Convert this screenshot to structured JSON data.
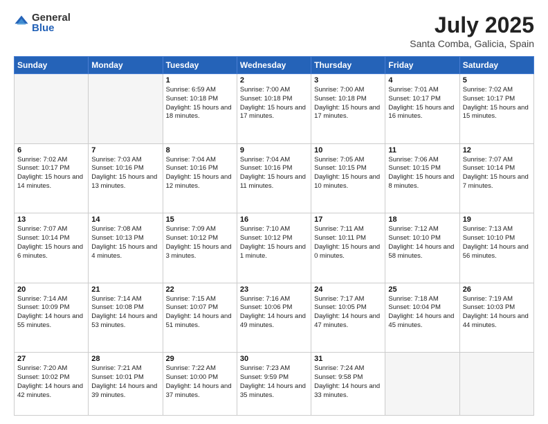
{
  "logo": {
    "general": "General",
    "blue": "Blue"
  },
  "title": "July 2025",
  "subtitle": "Santa Comba, Galicia, Spain",
  "weekdays": [
    "Sunday",
    "Monday",
    "Tuesday",
    "Wednesday",
    "Thursday",
    "Friday",
    "Saturday"
  ],
  "weeks": [
    [
      {
        "day": "",
        "empty": true
      },
      {
        "day": "",
        "empty": true
      },
      {
        "day": "1",
        "sunrise": "Sunrise: 6:59 AM",
        "sunset": "Sunset: 10:18 PM",
        "daylight": "Daylight: 15 hours and 18 minutes."
      },
      {
        "day": "2",
        "sunrise": "Sunrise: 7:00 AM",
        "sunset": "Sunset: 10:18 PM",
        "daylight": "Daylight: 15 hours and 17 minutes."
      },
      {
        "day": "3",
        "sunrise": "Sunrise: 7:00 AM",
        "sunset": "Sunset: 10:18 PM",
        "daylight": "Daylight: 15 hours and 17 minutes."
      },
      {
        "day": "4",
        "sunrise": "Sunrise: 7:01 AM",
        "sunset": "Sunset: 10:17 PM",
        "daylight": "Daylight: 15 hours and 16 minutes."
      },
      {
        "day": "5",
        "sunrise": "Sunrise: 7:02 AM",
        "sunset": "Sunset: 10:17 PM",
        "daylight": "Daylight: 15 hours and 15 minutes."
      }
    ],
    [
      {
        "day": "6",
        "sunrise": "Sunrise: 7:02 AM",
        "sunset": "Sunset: 10:17 PM",
        "daylight": "Daylight: 15 hours and 14 minutes."
      },
      {
        "day": "7",
        "sunrise": "Sunrise: 7:03 AM",
        "sunset": "Sunset: 10:16 PM",
        "daylight": "Daylight: 15 hours and 13 minutes."
      },
      {
        "day": "8",
        "sunrise": "Sunrise: 7:04 AM",
        "sunset": "Sunset: 10:16 PM",
        "daylight": "Daylight: 15 hours and 12 minutes."
      },
      {
        "day": "9",
        "sunrise": "Sunrise: 7:04 AM",
        "sunset": "Sunset: 10:16 PM",
        "daylight": "Daylight: 15 hours and 11 minutes."
      },
      {
        "day": "10",
        "sunrise": "Sunrise: 7:05 AM",
        "sunset": "Sunset: 10:15 PM",
        "daylight": "Daylight: 15 hours and 10 minutes."
      },
      {
        "day": "11",
        "sunrise": "Sunrise: 7:06 AM",
        "sunset": "Sunset: 10:15 PM",
        "daylight": "Daylight: 15 hours and 8 minutes."
      },
      {
        "day": "12",
        "sunrise": "Sunrise: 7:07 AM",
        "sunset": "Sunset: 10:14 PM",
        "daylight": "Daylight: 15 hours and 7 minutes."
      }
    ],
    [
      {
        "day": "13",
        "sunrise": "Sunrise: 7:07 AM",
        "sunset": "Sunset: 10:14 PM",
        "daylight": "Daylight: 15 hours and 6 minutes."
      },
      {
        "day": "14",
        "sunrise": "Sunrise: 7:08 AM",
        "sunset": "Sunset: 10:13 PM",
        "daylight": "Daylight: 15 hours and 4 minutes."
      },
      {
        "day": "15",
        "sunrise": "Sunrise: 7:09 AM",
        "sunset": "Sunset: 10:12 PM",
        "daylight": "Daylight: 15 hours and 3 minutes."
      },
      {
        "day": "16",
        "sunrise": "Sunrise: 7:10 AM",
        "sunset": "Sunset: 10:12 PM",
        "daylight": "Daylight: 15 hours and 1 minute."
      },
      {
        "day": "17",
        "sunrise": "Sunrise: 7:11 AM",
        "sunset": "Sunset: 10:11 PM",
        "daylight": "Daylight: 15 hours and 0 minutes."
      },
      {
        "day": "18",
        "sunrise": "Sunrise: 7:12 AM",
        "sunset": "Sunset: 10:10 PM",
        "daylight": "Daylight: 14 hours and 58 minutes."
      },
      {
        "day": "19",
        "sunrise": "Sunrise: 7:13 AM",
        "sunset": "Sunset: 10:10 PM",
        "daylight": "Daylight: 14 hours and 56 minutes."
      }
    ],
    [
      {
        "day": "20",
        "sunrise": "Sunrise: 7:14 AM",
        "sunset": "Sunset: 10:09 PM",
        "daylight": "Daylight: 14 hours and 55 minutes."
      },
      {
        "day": "21",
        "sunrise": "Sunrise: 7:14 AM",
        "sunset": "Sunset: 10:08 PM",
        "daylight": "Daylight: 14 hours and 53 minutes."
      },
      {
        "day": "22",
        "sunrise": "Sunrise: 7:15 AM",
        "sunset": "Sunset: 10:07 PM",
        "daylight": "Daylight: 14 hours and 51 minutes."
      },
      {
        "day": "23",
        "sunrise": "Sunrise: 7:16 AM",
        "sunset": "Sunset: 10:06 PM",
        "daylight": "Daylight: 14 hours and 49 minutes."
      },
      {
        "day": "24",
        "sunrise": "Sunrise: 7:17 AM",
        "sunset": "Sunset: 10:05 PM",
        "daylight": "Daylight: 14 hours and 47 minutes."
      },
      {
        "day": "25",
        "sunrise": "Sunrise: 7:18 AM",
        "sunset": "Sunset: 10:04 PM",
        "daylight": "Daylight: 14 hours and 45 minutes."
      },
      {
        "day": "26",
        "sunrise": "Sunrise: 7:19 AM",
        "sunset": "Sunset: 10:03 PM",
        "daylight": "Daylight: 14 hours and 44 minutes."
      }
    ],
    [
      {
        "day": "27",
        "sunrise": "Sunrise: 7:20 AM",
        "sunset": "Sunset: 10:02 PM",
        "daylight": "Daylight: 14 hours and 42 minutes."
      },
      {
        "day": "28",
        "sunrise": "Sunrise: 7:21 AM",
        "sunset": "Sunset: 10:01 PM",
        "daylight": "Daylight: 14 hours and 39 minutes."
      },
      {
        "day": "29",
        "sunrise": "Sunrise: 7:22 AM",
        "sunset": "Sunset: 10:00 PM",
        "daylight": "Daylight: 14 hours and 37 minutes."
      },
      {
        "day": "30",
        "sunrise": "Sunrise: 7:23 AM",
        "sunset": "Sunset: 9:59 PM",
        "daylight": "Daylight: 14 hours and 35 minutes."
      },
      {
        "day": "31",
        "sunrise": "Sunrise: 7:24 AM",
        "sunset": "Sunset: 9:58 PM",
        "daylight": "Daylight: 14 hours and 33 minutes."
      },
      {
        "day": "",
        "empty": true
      },
      {
        "day": "",
        "empty": true
      }
    ]
  ]
}
